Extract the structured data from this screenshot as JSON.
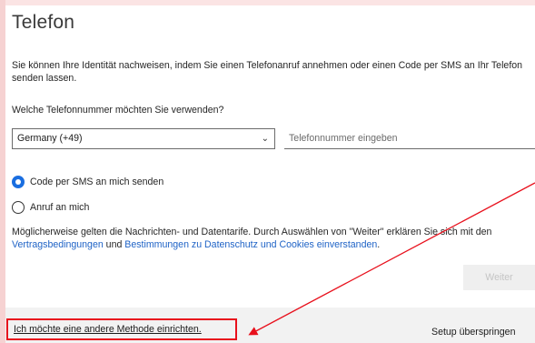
{
  "page": {
    "title": "Telefon",
    "description": "Sie können Ihre Identität nachweisen, indem Sie einen Telefonanruf annehmen oder einen Code per SMS an Ihr Telefon senden lassen.",
    "question": "Welche Telefonnummer möchten Sie verwenden?"
  },
  "country_select": {
    "value": "Germany (+49)"
  },
  "phone_input": {
    "placeholder": "Telefonnummer eingeben",
    "value": ""
  },
  "methods": [
    {
      "label": "Code per SMS an mich senden",
      "checked": true
    },
    {
      "label": "Anruf an mich",
      "checked": false
    }
  ],
  "legal": {
    "text_before": "Möglicherweise gelten die Nachrichten- und Datentarife. Durch Auswählen von \"Weiter\" erklären Sie sich mit den ",
    "terms_link": "Vertragsbedingungen",
    "text_middle": " und ",
    "privacy_link": "Bestimmungen zu Datenschutz und Cookies einverstanden",
    "text_after": "."
  },
  "buttons": {
    "next_label": "Weiter",
    "other_method_label": "Ich möchte eine andere Methode einrichten.",
    "skip_label": "Setup überspringen"
  },
  "annotation": {
    "highlight_color": "#e8101c",
    "accent_color": "#1a6ee0",
    "link_color": "#1f63c6"
  }
}
